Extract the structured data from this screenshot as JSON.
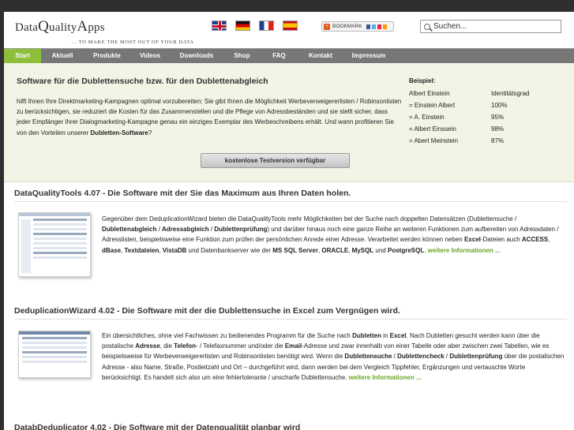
{
  "logo": {
    "brand_first": "Data",
    "brand_mid": "Q",
    "brand_rest1": "uality",
    "brand_a": "A",
    "brand_rest2": "pps",
    "tagline": "... TO MAKE THE MOST OUT OF YOUR DATA"
  },
  "flags": [
    "uk-flag-icon",
    "german-flag-icon",
    "french-flag-icon",
    "spanish-flag-icon"
  ],
  "bookmark": {
    "label": "BOOKMARK"
  },
  "search": {
    "placeholder": "Suchen..."
  },
  "nav": {
    "items": [
      "Start",
      "Aktuell",
      "Produkte",
      "Videos",
      "Downloads",
      "Shop",
      "FAQ",
      "Kontakt",
      "Impressum"
    ],
    "active": "Start",
    "active_color": "#8dbf3a"
  },
  "intro": {
    "title": "Software für die Dublettensuche bzw. für den Dublettenabgleich",
    "text_1": "hilft Ihnen Ihre Direktmarketing-Kampagnen optimal vorzubereiten: Sie gibt Ihnen die Möglichkeit Werbeverweigererlisten / Robinsonlisten zu berücksichtigen, sie reduziert die Kosten für das Zusammenstellen und die Pflege von Adressbeständen und sie stellt sicher, dass jeder Empfänger Ihrer Dialogmarketing-Kampagne genau ein einziges Exemplar des Werbeschreibens erhält. Und wann profitieren Sie von den Vorteilen unserer ",
    "text_bold": "Dubletten-Software",
    "text_2": "?",
    "cta": "kostenlose Testversion verfügbar"
  },
  "example": {
    "title": "Beispiel:",
    "rows": [
      [
        "Albert Einstein",
        "Identitätsgrad"
      ],
      [
        "= Einstein Albert",
        "100%"
      ],
      [
        "= A. Einstein",
        "95%"
      ],
      [
        "= Albert Einssein",
        "98%"
      ],
      [
        "= Abert Meinstein",
        "87%"
      ]
    ]
  },
  "sections": [
    {
      "title": "DataQualityTools 4.07 - Die Software mit der Sie das Maximum aus Ihren Daten holen.",
      "parts": [
        [
          "Gegenüber dem DeduplicationWizard bieten die DataQualityTools mehr Möglichkeiten bei der Suche nach doppelten Datensätzen (Dublettensuche / ",
          0
        ],
        [
          "Dublettenabgleich",
          1
        ],
        [
          " / ",
          0
        ],
        [
          "Adressabgleich",
          1
        ],
        [
          " / ",
          0
        ],
        [
          "Dublettenprüfung",
          1
        ],
        [
          ") und darüber hinaus noch eine ganze Reihe an weiteren Funktionen zum aufbereiten von Adressdaten / Adresslisten, beispielsweise eine Funktion zum prüfen der persönlichen Anrede einer Adresse. Verarbeitet werden können neben ",
          0
        ],
        [
          "Excel",
          1
        ],
        [
          "-Dateien auch ",
          0
        ],
        [
          "ACCESS",
          1
        ],
        [
          ", ",
          0
        ],
        [
          "dBase",
          1
        ],
        [
          ", ",
          0
        ],
        [
          "Textdateien",
          1
        ],
        [
          ", ",
          0
        ],
        [
          "VistaDB",
          1
        ],
        [
          " und Datenbankserver wie der ",
          0
        ],
        [
          "MS SQL Server",
          1
        ],
        [
          ", ",
          0
        ],
        [
          "ORACLE",
          1
        ],
        [
          ", ",
          0
        ],
        [
          "MySQL",
          1
        ],
        [
          " und ",
          0
        ],
        [
          "PostgreSQL",
          1
        ],
        [
          ". ",
          0
        ]
      ],
      "more": "weitere Informationen ..."
    },
    {
      "title": "DeduplicationWizard 4.02 - Die Software mit der die Dublettensuche in Excel zum Vergnügen wird.",
      "parts": [
        [
          "Ein übersichtliches, ohne viel Fachwissen zu bedienendes Programm für die Suche nach ",
          0
        ],
        [
          "Dubletten",
          1
        ],
        [
          " in ",
          0
        ],
        [
          "Excel",
          1
        ],
        [
          ". Nach Dubletten gesucht werden kann über die postalische ",
          0
        ],
        [
          "Adresse",
          1
        ],
        [
          ", die ",
          0
        ],
        [
          "Telefon",
          1
        ],
        [
          "- / Telefaxnummer und/oder die ",
          0
        ],
        [
          "Email",
          1
        ],
        [
          "-Adresse und zwar innerhalb von einer Tabelle oder aber zwischen zwei Tabellen, wie es beispielsweise für Werbeverweigererlisten und Robinsonlisten benötigt wird. Wenn die ",
          0
        ],
        [
          "Dublettensuche",
          1
        ],
        [
          " / ",
          0
        ],
        [
          "Dublettencheck",
          1
        ],
        [
          " / ",
          0
        ],
        [
          "Dublettenprüfung",
          1
        ],
        [
          " über die postalischen Adresse - also Name, Straße, Postleitzahl und Ort – durchgeführt wird, dann werden bei dem Vergleich Tippfehler, Ergänzungen und vertauschte Worte berücksichtigt. Es handelt sich also um eine fehlertolerante / unscharfe Dublettensuche. ",
          0
        ]
      ],
      "more": "weitere Informationen ..."
    }
  ],
  "cut_title": "DatabDeduplicator 4.02 - Die Software mit der Datenqualität planbar wird"
}
